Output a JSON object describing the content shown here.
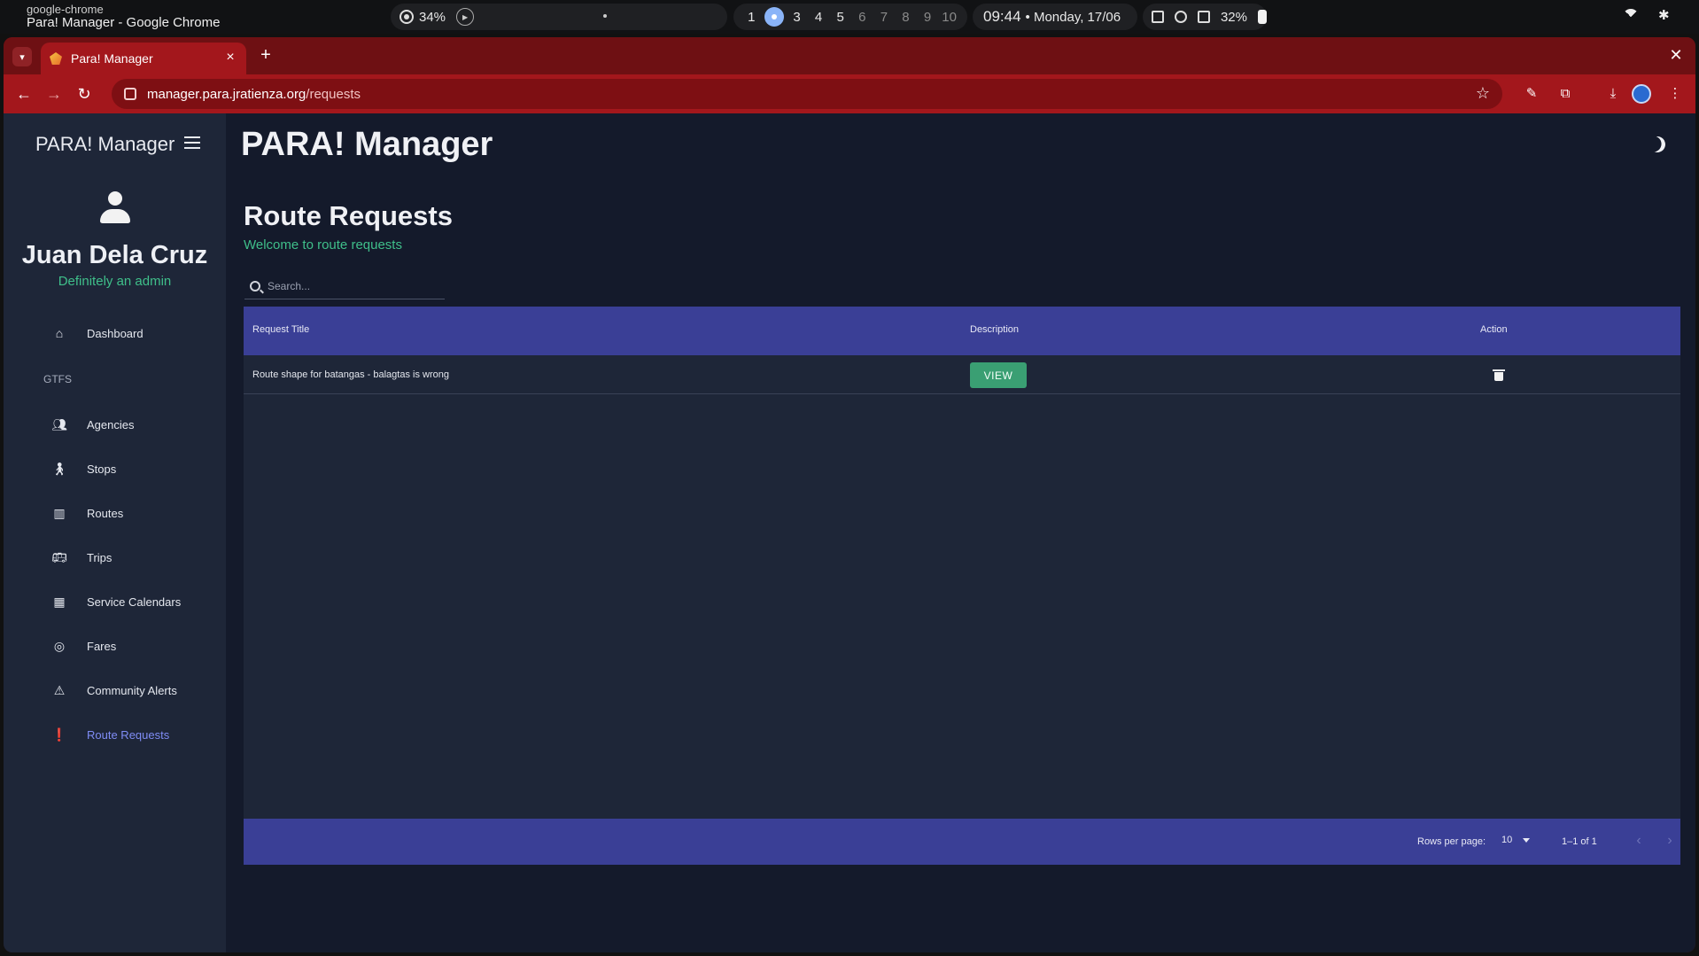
{
  "os": {
    "app_id": "google-chrome",
    "window_title": "Para! Manager - Google Chrome",
    "cpu": "34%",
    "workspaces": [
      "1",
      "2",
      "3",
      "4",
      "5",
      "6",
      "7",
      "8",
      "9",
      "10"
    ],
    "active_workspace": "2",
    "time": "09:44",
    "date": "• Monday, 17/06",
    "battery": "32%"
  },
  "browser": {
    "tab_title": "Para! Manager",
    "url_host": "manager.para.jratienza.org",
    "url_path": "/requests",
    "tab_color": "#a3171c",
    "frame_color": "#6e1013"
  },
  "sidebar": {
    "title": "PARA! Manager",
    "user_name": "Juan Dela Cruz",
    "user_role": "Definitely an admin",
    "dashboard": "Dashboard",
    "section_label": "GTFS",
    "items": [
      {
        "label": "Agencies",
        "icon": "people-icon"
      },
      {
        "label": "Stops",
        "icon": "walking-person-icon"
      },
      {
        "label": "Routes",
        "icon": "map-icon"
      },
      {
        "label": "Trips",
        "icon": "bus-icon"
      },
      {
        "label": "Service Calendars",
        "icon": "calendar-icon"
      },
      {
        "label": "Fares",
        "icon": "fare-icon"
      },
      {
        "label": "Community Alerts",
        "icon": "alert-bus-icon"
      },
      {
        "label": "Route Requests",
        "icon": "feedback-icon"
      }
    ],
    "active_item": "Route Requests",
    "accent": "#7f8cf5"
  },
  "header": {
    "app_title": "PARA! Manager"
  },
  "main": {
    "page_title": "Route Requests",
    "page_subtitle": "Welcome to route requests",
    "search_placeholder": "Search...",
    "table": {
      "columns": [
        "Request Title",
        "Description",
        "Action"
      ],
      "rows": [
        {
          "title": "Route shape for batangas - balagtas is wrong",
          "description_button": "VIEW"
        }
      ],
      "header_color": "#3a3f96"
    },
    "pagination": {
      "rows_per_page_label": "Rows per page:",
      "rows_per_page": "10",
      "range": "1–1 of 1"
    },
    "success_color": "#3fbf8a"
  }
}
